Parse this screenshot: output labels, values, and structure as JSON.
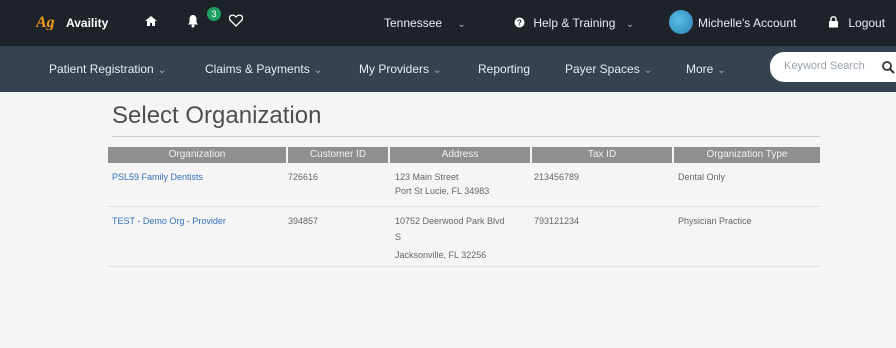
{
  "top_bar": {
    "brand": "Availity",
    "notification_count": "3",
    "state_selector": "Tennessee",
    "help": "Help & Training",
    "account": "Michelle's Account",
    "logout": "Logout"
  },
  "nav": {
    "items": [
      {
        "label": "Patient Registration",
        "dropdown": true
      },
      {
        "label": "Claims & Payments",
        "dropdown": true
      },
      {
        "label": "My Providers",
        "dropdown": true
      },
      {
        "label": "Reporting",
        "dropdown": false
      },
      {
        "label": "Payer Spaces",
        "dropdown": true
      },
      {
        "label": "More",
        "dropdown": true
      }
    ],
    "search_placeholder": "Keyword Search"
  },
  "page": {
    "title": "Select Organization"
  },
  "table": {
    "headers": [
      "Organization",
      "Customer ID",
      "Address",
      "Tax ID",
      "Organization Type"
    ],
    "rows": [
      {
        "organization": "PSL59 Family Dentists",
        "customer_id": "726616",
        "address_line1": "123 Main Street",
        "address_line2": "Port St Lucie, FL 34983",
        "address_line3": "",
        "tax_id": "213456789",
        "org_type": "Dental Only"
      },
      {
        "organization": "TEST - Demo Org - Provider",
        "customer_id": "394857",
        "address_line1": "10752 Deerwood Park Blvd",
        "address_line2": "S",
        "address_line3": "Jacksonville, FL 32256",
        "tax_id": "793121234",
        "org_type": "Physician Practice"
      }
    ]
  }
}
